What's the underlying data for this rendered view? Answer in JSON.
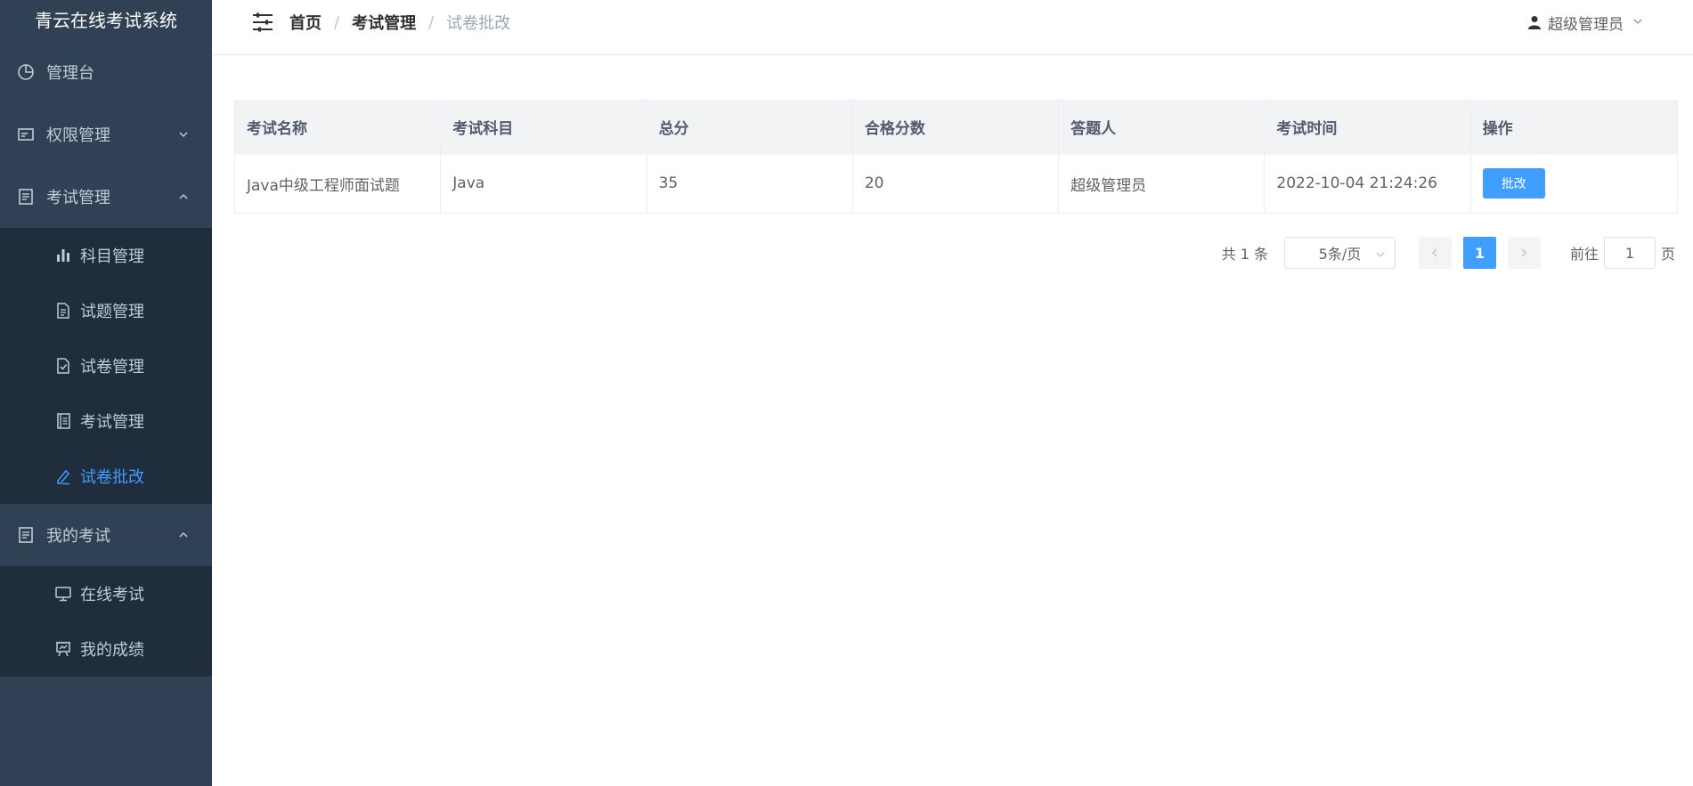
{
  "sidebar": {
    "brand": "青云在线考试系统",
    "menu": {
      "dashboard": "管理台",
      "permission": "权限管理",
      "exam_mgmt": "考试管理",
      "my_exam": "我的考试"
    },
    "exam_mgmt_children": {
      "subject": "科目管理",
      "question": "试题管理",
      "paper": "试卷管理",
      "exam": "考试管理",
      "marking": "试卷批改"
    },
    "my_exam_children": {
      "online": "在线考试",
      "scores": "我的成绩"
    }
  },
  "header": {
    "breadcrumb": {
      "home": "首页",
      "section": "考试管理",
      "current": "试卷批改"
    },
    "user": "超级管理员"
  },
  "table": {
    "headers": {
      "name": "考试名称",
      "subject": "考试科目",
      "total": "总分",
      "pass": "合格分数",
      "answerer": "答题人",
      "time": "考试时间",
      "op": "操作"
    },
    "rows": [
      {
        "name": "Java中级工程师面试题",
        "subject": "Java",
        "total": "35",
        "pass": "20",
        "answerer": "超级管理员",
        "time": "2022-10-04 21:24:26",
        "action": "批改"
      }
    ]
  },
  "pagination": {
    "total": "共 1 条",
    "page_size": "5条/页",
    "current_page": "1",
    "goto_label": "前往",
    "goto_value": "1",
    "page_suffix": "页"
  },
  "colors": {
    "sidebar_bg": "#304156",
    "submenu_bg": "#1f2d3d",
    "accent": "#409eff"
  }
}
